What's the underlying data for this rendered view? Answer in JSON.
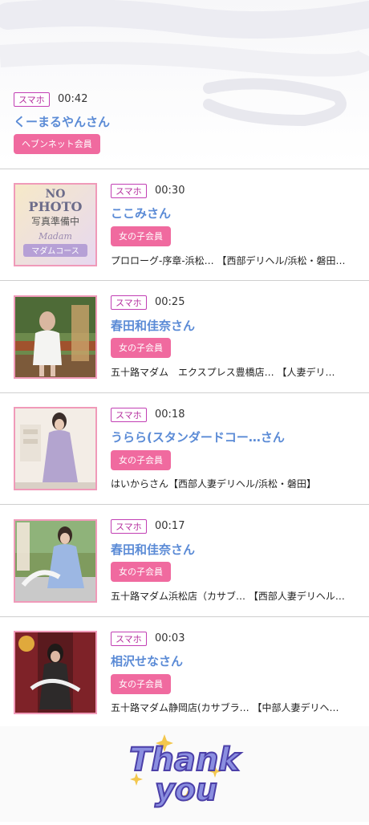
{
  "entries": [
    {
      "device": "スマホ",
      "time": "00:42",
      "name": "くーまるやんさん",
      "member_type": "ヘブンネット会員",
      "shop": ""
    },
    {
      "device": "スマホ",
      "time": "00:30",
      "name": "ここみさん",
      "member_type": "女の子会員",
      "shop": "プロローグ-序章-浜松… 【西部デリヘル/浜松・磐田…",
      "photo_text": {
        "line1": "NO",
        "line2": "PHOTO",
        "line3": "写真準備中",
        "script": "Madam",
        "course": "マダムコース"
      }
    },
    {
      "device": "スマホ",
      "time": "00:25",
      "name": "春田和佳奈さん",
      "member_type": "女の子会員",
      "shop": "五十路マダム　エクスプレス豊橋店… 【人妻デリ…"
    },
    {
      "device": "スマホ",
      "time": "00:18",
      "name": "うらら(スタンダードコー…さん",
      "member_type": "女の子会員",
      "shop": "はいからさん【西部人妻デリヘル/浜松・磐田】"
    },
    {
      "device": "スマホ",
      "time": "00:17",
      "name": "春田和佳奈さん",
      "member_type": "女の子会員",
      "shop": "五十路マダム浜松店（カサブ… 【西部人妻デリヘル…"
    },
    {
      "device": "スマホ",
      "time": "00:03",
      "name": "相沢せなさん",
      "member_type": "女の子会員",
      "shop": "五十路マダム静岡店(カサブラ… 【中部人妻デリヘ…"
    }
  ],
  "footer": {
    "thank_you_line1": "Thank",
    "thank_you_line2": "you"
  },
  "colors": {
    "name_blue": "#5b8bd6",
    "badge_pink": "#f06a9f",
    "tag_purple": "#b5309f",
    "photo_border": "#f09ab9"
  }
}
